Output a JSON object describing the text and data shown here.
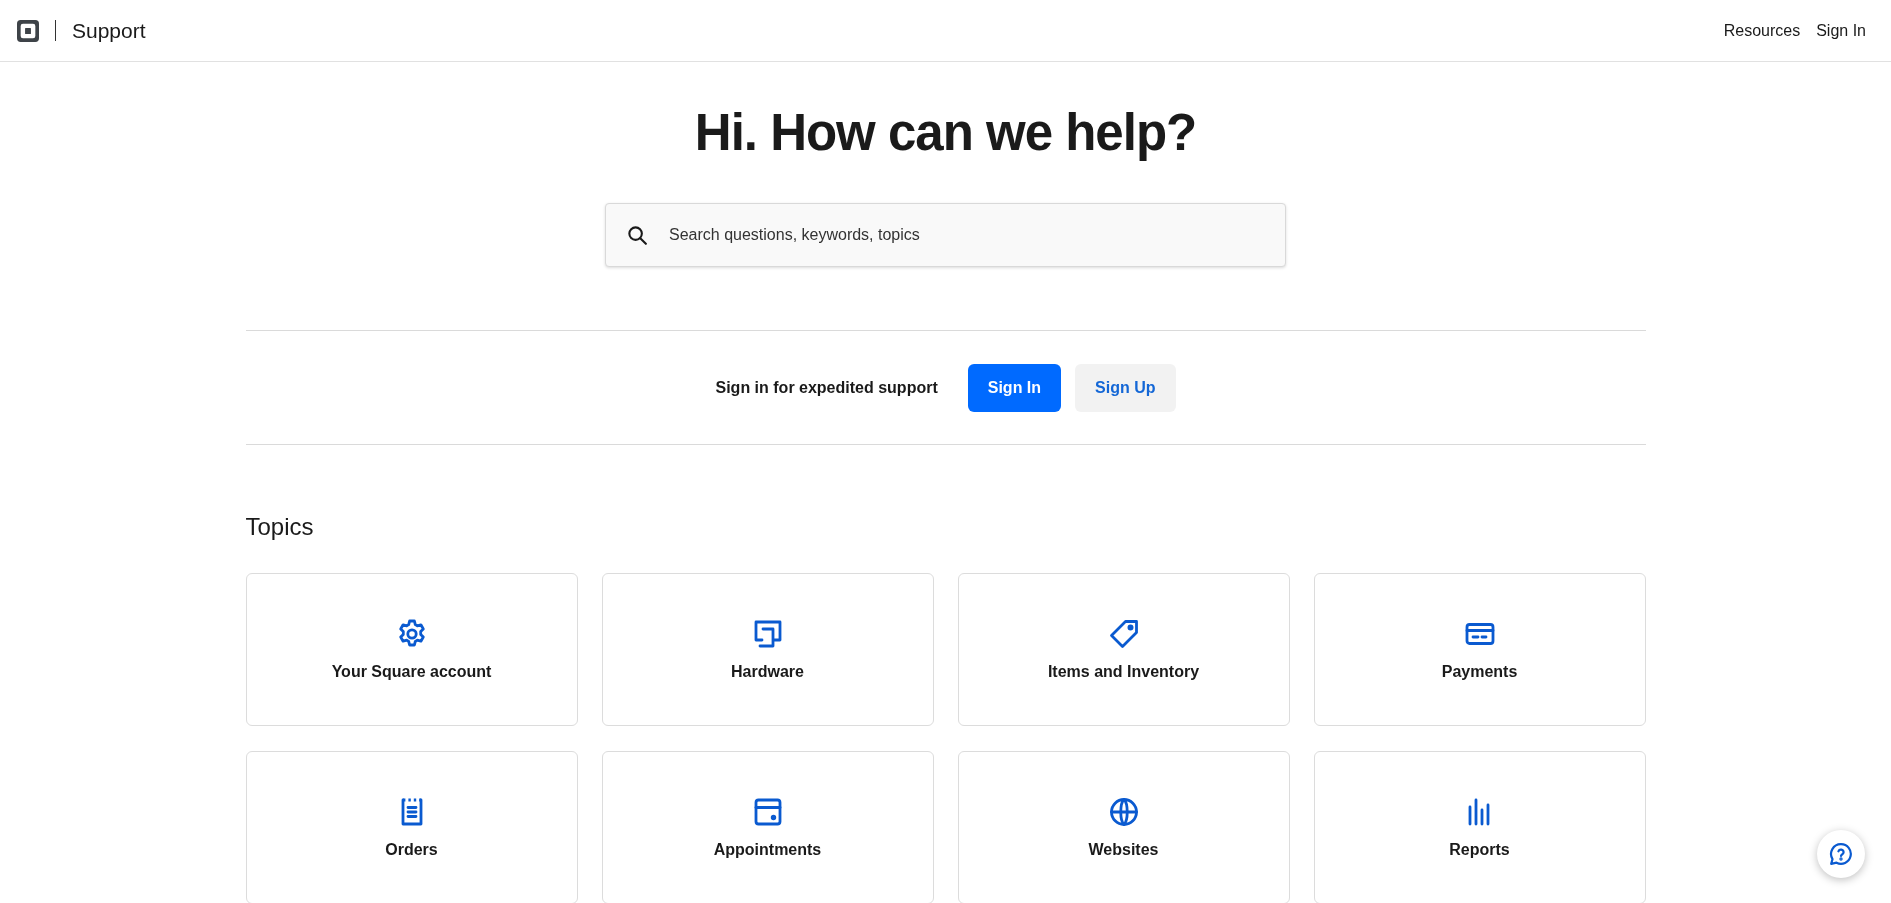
{
  "header": {
    "title": "Support",
    "nav": [
      {
        "label": "Resources"
      },
      {
        "label": "Sign In"
      }
    ]
  },
  "hero": {
    "heading": "Hi. How can we help?",
    "search": {
      "placeholder": "Search questions, keywords, topics"
    }
  },
  "signin": {
    "prompt": "Sign in for expedited support",
    "buttons": [
      {
        "label": "Sign In",
        "kind": "primary"
      },
      {
        "label": "Sign Up",
        "kind": "secondary"
      }
    ]
  },
  "topics": {
    "title": "Topics",
    "items": [
      {
        "label": "Your Square account"
      },
      {
        "label": "Hardware"
      },
      {
        "label": "Items and Inventory"
      },
      {
        "label": "Payments"
      },
      {
        "label": "Orders"
      },
      {
        "label": "Appointments"
      },
      {
        "label": "Websites"
      },
      {
        "label": "Reports"
      }
    ]
  }
}
